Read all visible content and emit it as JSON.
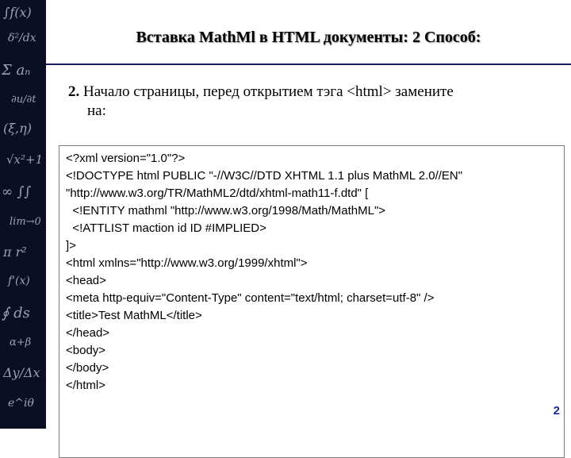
{
  "slide": {
    "title": "Вставка MathMl в HTML документы: 2 Способ:",
    "step": {
      "number": "2.",
      "text_line1": "Начало страницы, перед открытием тэга <html> замените",
      "text_line2": "на:"
    },
    "code_lines": [
      "<?xml version=\"1.0\"?>",
      "<!DOCTYPE html PUBLIC \"-//W3C//DTD XHTML 1.1 plus MathML 2.0//EN\"",
      "\"http://www.w3.org/TR/MathML2/dtd/xhtml-math11-f.dtd\" [",
      "  <!ENTITY mathml \"http://www.w3.org/1998/Math/MathML\">",
      "  <!ATTLIST maction id ID #IMPLIED>",
      "]>",
      "<html xmlns=\"http://www.w3.org/1999/xhtml\">",
      "<head>",
      "<meta http-equiv=\"Content-Type\" content=\"text/html; charset=utf-8\" />",
      "<title>Test MathML</title>",
      "</head>",
      "<body>",
      "</body>",
      "</html>"
    ],
    "page_number": "2",
    "colors": {
      "sidebar": "#0b0f24",
      "divider": "#1a1a66",
      "page_number": "#1b2a9a"
    }
  }
}
